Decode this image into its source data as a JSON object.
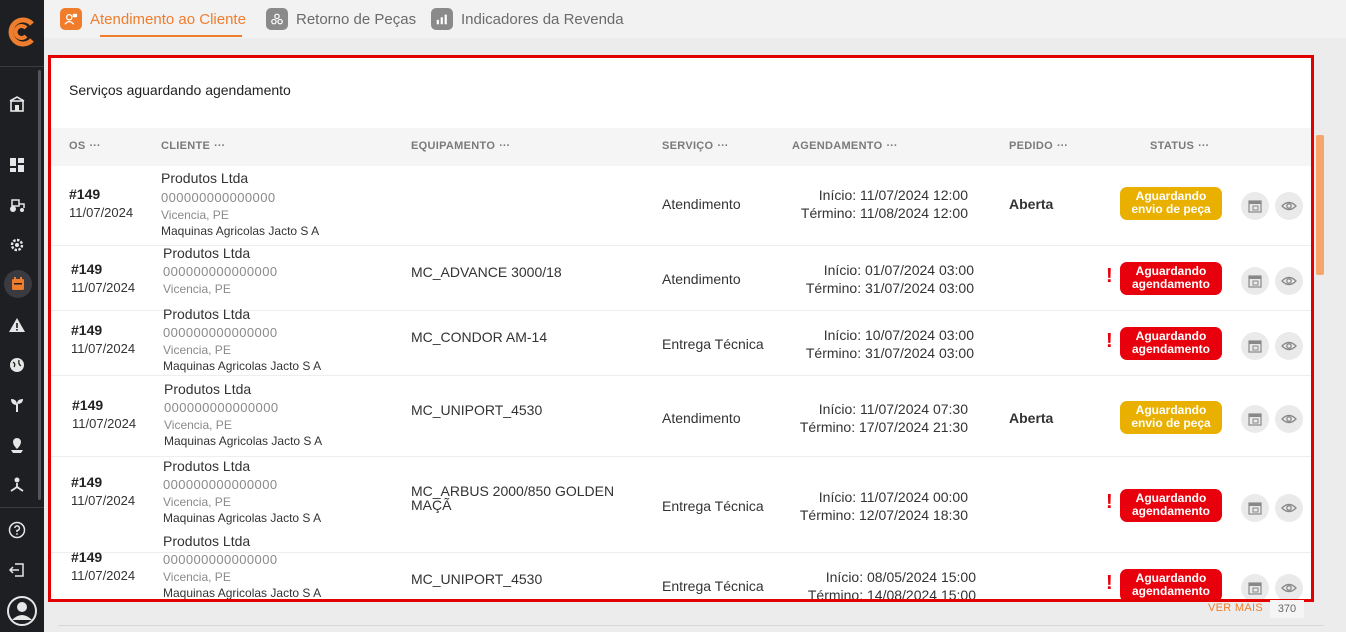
{
  "tabs": [
    {
      "label": "Atendimento ao Cliente",
      "icon": "customer-service-icon",
      "active": true
    },
    {
      "label": "Retorno de Peças",
      "icon": "parts-return-icon",
      "active": false
    },
    {
      "label": "Indicadores da Revenda",
      "icon": "bar-chart-icon",
      "active": false
    }
  ],
  "sidebar": {
    "icons": [
      "building-icon",
      "dashboard-icon",
      "tractor-icon",
      "settings-icon",
      "calendar-icon",
      "warning-icon",
      "globe-icon",
      "plant-icon",
      "location-icon",
      "org-chart-icon",
      "help-icon",
      "logout-icon",
      "user-avatar-icon"
    ]
  },
  "card": {
    "title": "Serviços aguardando agendamento",
    "columns": {
      "os": "OS",
      "cliente": "CLIENTE",
      "equipamento": "EQUIPAMENTO",
      "servico": "SERVIÇO",
      "agendamento": "AGENDAMENTO",
      "pedido": "PEDIDO",
      "status": "STATUS",
      "dots": "···"
    },
    "labels": {
      "inicio": "Início:",
      "termino": "Término:"
    },
    "rows": [
      {
        "os": "#149",
        "date": "11/07/2024",
        "client": "Produtos Ltda",
        "doc": "000000000000000",
        "city": "Vicencia, PE",
        "company": "Maquinas Agricolas Jacto S A",
        "equipment": "",
        "service": "Atendimento",
        "start": "11/07/2024 12:00",
        "end": "11/08/2024 12:00",
        "pedido": "Aberta",
        "status": "Aguardando envio de peça",
        "status_color": "#e9b000",
        "alert": ""
      },
      {
        "os": "#149",
        "date": "11/07/2024",
        "client": "Produtos Ltda",
        "doc": "000000000000000",
        "city": "Vicencia, PE",
        "company": "",
        "equipment": "MC_ADVANCE 3000/18",
        "service": "Atendimento",
        "start": "01/07/2024 03:00",
        "end": "31/07/2024 03:00",
        "pedido": "",
        "status": "Aguardando agendamento",
        "status_color": "#e8000c",
        "alert": "!"
      },
      {
        "os": "#149",
        "date": "11/07/2024",
        "client": "Produtos Ltda",
        "doc": "000000000000000",
        "city": "Vicencia, PE",
        "company": "Maquinas Agricolas Jacto S A",
        "equipment": "MC_CONDOR AM-14",
        "service": "Entrega Técnica",
        "start": "10/07/2024 03:00",
        "end": "31/07/2024 03:00",
        "pedido": "",
        "status": "Aguardando agendamento",
        "status_color": "#e8000c",
        "alert": "!"
      },
      {
        "os": "#149",
        "date": "11/07/2024",
        "client": "Produtos Ltda",
        "doc": "000000000000000",
        "city": "Vicencia, PE",
        "company": "Maquinas Agricolas Jacto S A",
        "equipment": "MC_UNIPORT_4530",
        "service": "Atendimento",
        "start": "11/07/2024 07:30",
        "end": "17/07/2024 21:30",
        "pedido": "Aberta",
        "status": "Aguardando envio de peça",
        "status_color": "#e9b000",
        "alert": ""
      },
      {
        "os": "#149",
        "date": "11/07/2024",
        "client": "Produtos Ltda",
        "doc": "000000000000000",
        "city": "Vicencia, PE",
        "company": "Maquinas Agricolas Jacto S A",
        "equipment": "MC_ARBUS 2000/850 GOLDEN MAÇÃ",
        "service": "Entrega Técnica",
        "start": "11/07/2024 00:00",
        "end": "12/07/2024 18:30",
        "pedido": "",
        "status": "Aguardando agendamento",
        "status_color": "#e8000c",
        "alert": "!"
      },
      {
        "os": "#149",
        "date": "11/07/2024",
        "client": "Produtos Ltda",
        "doc": "000000000000000",
        "city": "Vicencia, PE",
        "company": "Maquinas Agricolas Jacto S A",
        "equipment": "MC_UNIPORT_4530",
        "service": "Entrega Técnica",
        "start": "08/05/2024 15:00",
        "end": "14/08/2024 15:00",
        "pedido": "",
        "status": "Aguardando agendamento",
        "status_color": "#e8000c",
        "alert": "!"
      }
    ]
  },
  "footer": {
    "ver_mais": "VER MAIS",
    "count": "370"
  }
}
